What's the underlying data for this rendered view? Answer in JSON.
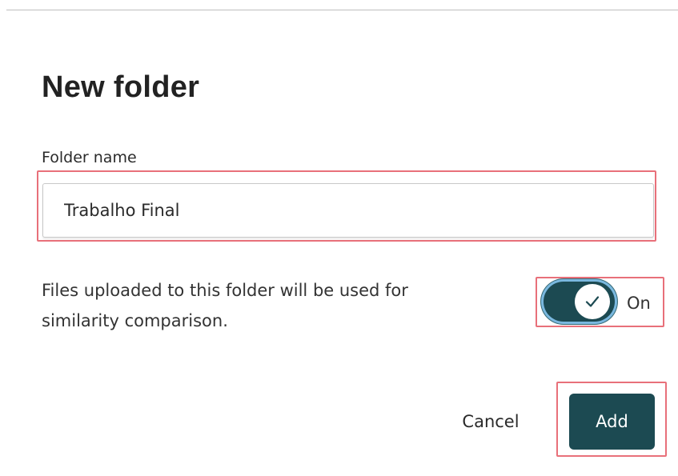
{
  "dialog": {
    "title": "New folder",
    "folder_name_label": "Folder name",
    "folder_name_value": "Trabalho Final",
    "description": "Files uploaded to this folder will be used for similarity comparison.",
    "toggle": {
      "state_label": "On",
      "checked": true,
      "icon": "checkmark-icon",
      "color": "#1c4a52"
    },
    "cancel_label": "Cancel",
    "add_label": "Add"
  },
  "colors": {
    "accent": "#1c4a52",
    "highlight": "#e8707a"
  }
}
